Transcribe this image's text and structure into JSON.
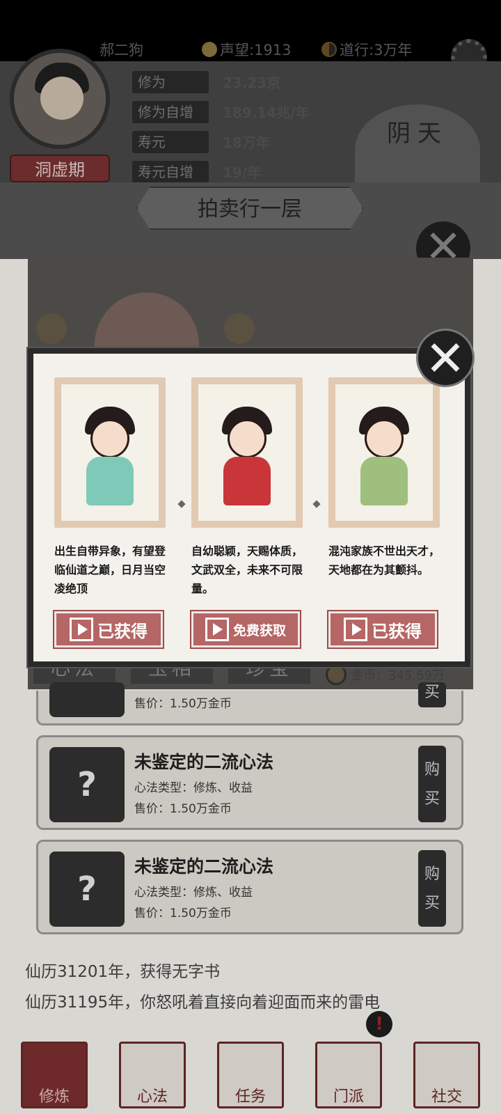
{
  "player": {
    "name": "郝二狗",
    "reputation": "声望:1913",
    "dao": "道行:3万年",
    "realm": "洞虚期"
  },
  "stats": [
    {
      "label": "修为",
      "value": "23.23京"
    },
    {
      "label": "修为自增",
      "value": "189.14兆/年"
    },
    {
      "label": "寿元",
      "value": "18万年"
    },
    {
      "label": "寿元自增",
      "value": "19/年"
    }
  ],
  "weather": "阴天",
  "auction": {
    "title": "拍卖行一层",
    "tabs": [
      "心法",
      "玉相",
      "珍宝"
    ],
    "gold": "金币：345.59万",
    "items": [
      {
        "price": "售价：1.50万金币",
        "buy": "买"
      },
      {
        "name": "未鉴定的二流心法",
        "type": "心法类型：修炼、收益",
        "price": "售价：1.50万金币",
        "buy1": "购",
        "buy2": "买"
      },
      {
        "name": "未鉴定的二流心法",
        "type": "心法类型：修炼、收益",
        "price": "售价：1.50万金币",
        "buy1": "购",
        "buy2": "买"
      }
    ]
  },
  "modal": {
    "cards": [
      {
        "desc": "出生自带异象，有望登临仙道之巅，日月当空凌绝顶",
        "button": "已获得"
      },
      {
        "desc": "自幼聪颖，天赐体质，文武双全，未来不可限量。",
        "button": "免费获取"
      },
      {
        "desc": "混沌家族不世出天才，天地都在为其颤抖。",
        "button": "已获得"
      }
    ],
    "close": "✕"
  },
  "log": [
    "仙历31201年，获得无字书",
    "仙历31195年，你怒吼着直接向着迎面而来的雷电"
  ],
  "nav": [
    "修炼",
    "心法",
    "任务",
    "门派",
    "社交"
  ],
  "colors": {
    "accent": "#b56665",
    "frame": "#2a2a2a",
    "paper": "#f3f1ec"
  }
}
